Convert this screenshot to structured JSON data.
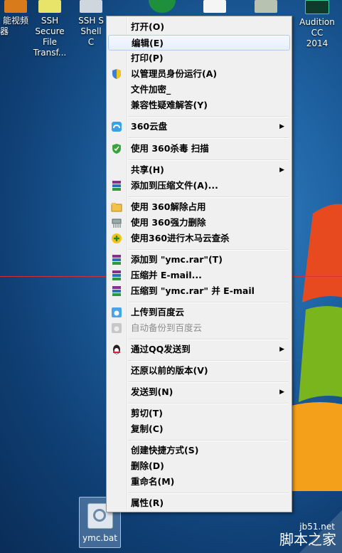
{
  "desktop": {
    "icons": [
      {
        "label1": "能视频",
        "label2": "器"
      },
      {
        "label1": "SSH Secure",
        "label2": "File Transf..."
      },
      {
        "label1": "SSH S",
        "label2": "Shell C"
      },
      {
        "label1": "",
        "label2": ""
      },
      {
        "label1": "",
        "label2": ""
      },
      {
        "label1": "",
        "label2": ""
      },
      {
        "label1": "Audition CC",
        "label2": "2014"
      }
    ],
    "file": {
      "label": "ymc.bat"
    }
  },
  "menu": {
    "items": [
      {
        "label": "打开(O)"
      },
      {
        "label": "编辑(E)"
      },
      {
        "label": "打印(P)"
      },
      {
        "label": "以管理员身份运行(A)"
      },
      {
        "label": "文件加密_"
      },
      {
        "label": "兼容性疑难解答(Y)"
      },
      {
        "label": "360云盘"
      },
      {
        "label": "使用 360杀毒 扫描"
      },
      {
        "label": "共享(H)"
      },
      {
        "label": "添加到压缩文件(A)..."
      },
      {
        "label": "使用 360解除占用"
      },
      {
        "label": "使用 360强力删除"
      },
      {
        "label": "使用360进行木马云查杀"
      },
      {
        "label": "添加到 \"ymc.rar\"(T)"
      },
      {
        "label": "压缩并 E-mail..."
      },
      {
        "label": "压缩到 \"ymc.rar\" 并 E-mail"
      },
      {
        "label": "上传到百度云"
      },
      {
        "label": "自动备份到百度云"
      },
      {
        "label": "通过QQ发送到"
      },
      {
        "label": "还原以前的版本(V)"
      },
      {
        "label": "发送到(N)"
      },
      {
        "label": "剪切(T)"
      },
      {
        "label": "复制(C)"
      },
      {
        "label": "创建快捷方式(S)"
      },
      {
        "label": "删除(D)"
      },
      {
        "label": "重命名(M)"
      },
      {
        "label": "属性(R)"
      }
    ]
  },
  "watermark": {
    "site": "jb51.net",
    "name": "脚本之家"
  },
  "colors": {
    "accent": "#b3cce8",
    "desktop": "#1d5f9e",
    "menu_bg": "#f0f0f0"
  }
}
